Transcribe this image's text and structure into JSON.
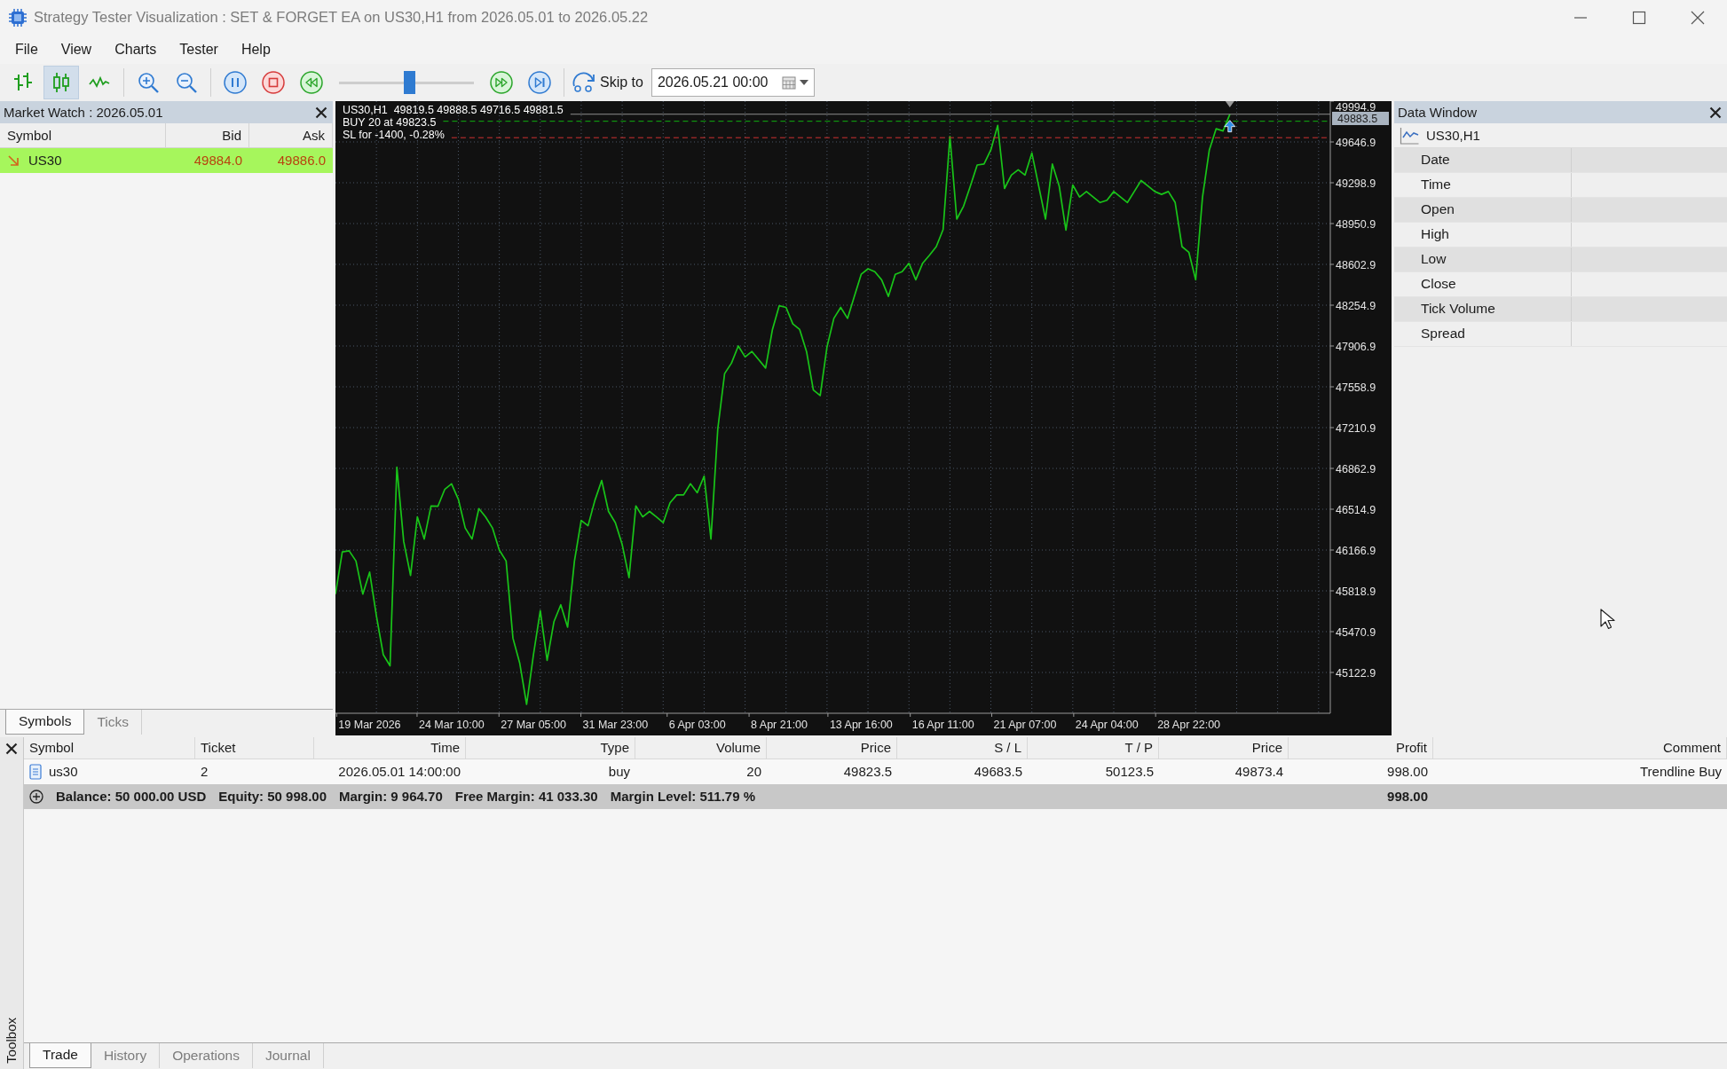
{
  "window": {
    "title": "Strategy Tester Visualization : SET & FORGET EA on US30,H1 from 2026.05.01 to 2026.05.22"
  },
  "menu": [
    "File",
    "View",
    "Charts",
    "Tester",
    "Help"
  ],
  "toolbar": {
    "chart_types": [
      {
        "kind": "bars",
        "selected": false
      },
      {
        "kind": "candles",
        "selected": true
      },
      {
        "kind": "line",
        "selected": false
      }
    ],
    "speed": {
      "level": 0.52
    },
    "skip_to": {
      "label": "Skip to",
      "value": "2026.05.21 00:00"
    }
  },
  "market_watch": {
    "title": "Market Watch : 2026.05.01",
    "columns": [
      "Symbol",
      "Bid",
      "Ask"
    ],
    "rows": [
      {
        "symbol": "US30",
        "bid": "49884.0",
        "ask": "49886.0",
        "falling": true,
        "selected": true
      }
    ],
    "tabs": [
      {
        "label": "Symbols",
        "selected": true
      },
      {
        "label": "Ticks",
        "selected": false
      }
    ]
  },
  "chart": {
    "ohlc": [
      "49819.5",
      "49888.5",
      "49716.5",
      "49881.5"
    ],
    "chart_data": {
      "type": "line",
      "grid": true,
      "categories": [
        null,
        null,
        null,
        null,
        null,
        "19 Mar 2026",
        null,
        null,
        null,
        null,
        null,
        null,
        null,
        null,
        null,
        null,
        null,
        "24 Mar 10:00",
        null,
        null,
        null,
        null,
        null,
        null,
        null,
        null,
        null,
        null,
        null,
        "27 Mar 05:00",
        null,
        null,
        null,
        null,
        null,
        null,
        null,
        null,
        null,
        null,
        null,
        "31 Mar 23:00",
        null,
        null,
        null,
        null,
        null,
        null,
        null,
        null,
        null,
        null,
        null,
        "6 Apr 03:00",
        null,
        null,
        null,
        null,
        null,
        null,
        null,
        null,
        null,
        null,
        null,
        "8 Apr 21:00",
        null,
        null,
        null,
        null,
        null,
        null,
        null,
        null,
        null,
        null,
        null,
        "13 Apr 16:00",
        null,
        null,
        null,
        null,
        null,
        null,
        null,
        null,
        null,
        null,
        null,
        "16 Apr 11:00",
        null,
        null,
        null,
        null,
        null,
        null,
        null,
        null,
        null,
        null,
        null,
        "21 Apr 07:00",
        null,
        null,
        null,
        null,
        null,
        null,
        null,
        null,
        null,
        null,
        null,
        "24 Apr 04:00",
        null,
        null,
        null,
        null,
        null,
        null,
        null,
        null,
        null,
        null,
        null,
        "28 Apr 22:00",
        null,
        null,
        null,
        null,
        null,
        null
      ],
      "series": [
        {
          "name": "US30,H1",
          "color": "#19c419",
          "values": [
            45791,
            46150,
            46160,
            46073,
            45791,
            45979,
            45603,
            45274,
            45180,
            46873,
            46240,
            45950,
            46449,
            46261,
            46543,
            46540,
            46684,
            46732,
            46600,
            46355,
            46261,
            46520,
            46449,
            46355,
            46167,
            46073,
            45415,
            45200,
            44851,
            45274,
            45650,
            45227,
            45556,
            45700,
            45509,
            46073,
            46420,
            46374,
            46590,
            46760,
            46496,
            46400,
            46214,
            45932,
            46543,
            46450,
            46496,
            46449,
            46400,
            46570,
            46637,
            46637,
            46732,
            46656,
            46797,
            46261,
            47200,
            47672,
            47760,
            47907,
            47813,
            47860,
            47790,
            47719,
            48048,
            48250,
            48236,
            48095,
            48048,
            47860,
            47531,
            47484,
            47900,
            48142,
            48236,
            48142,
            48330,
            48518,
            48565,
            48540,
            48471,
            48330,
            48518,
            48540,
            48612,
            48471,
            48612,
            48680,
            48754,
            48900,
            49694,
            48989,
            49100,
            49271,
            49450,
            49459,
            49580,
            49788,
            49250,
            49365,
            49410,
            49365,
            49553,
            49271,
            48989,
            49459,
            49271,
            48895,
            49280,
            49177,
            49224,
            49177,
            49130,
            49150,
            49224,
            49177,
            49130,
            49224,
            49318,
            49271,
            49224,
            49200,
            49224,
            49130,
            48754,
            48707,
            48471,
            49177,
            49580,
            49760,
            49741,
            49882
          ]
        }
      ],
      "ylim": [
        44775,
        49995
      ],
      "yticks": [
        49994.9,
        49646.9,
        49298.9,
        48950.9,
        48602.9,
        48254.9,
        47906.9,
        47558.9,
        47210.9,
        46862.9,
        46514.9,
        46166.9,
        45818.9,
        45470.9,
        45122.9
      ],
      "ref_lines": [
        {
          "axis": "y",
          "value": 49883.5,
          "label": "49883.5",
          "color": "#8c8c8c"
        },
        {
          "axis": "y",
          "value": 49823.5,
          "label": "BUY 20 at 49823.5",
          "color": "#10b010"
        },
        {
          "axis": "y",
          "value": 49683.5,
          "label": "SL for -1400, -0.28%",
          "color": "#d03232"
        }
      ]
    }
  },
  "data_window": {
    "title": "Data Window",
    "symbol": "US30,H1",
    "fields": [
      "Date",
      "Time",
      "Open",
      "High",
      "Low",
      "Close",
      "Tick Volume",
      "Spread"
    ]
  },
  "toolbox": {
    "title": "Toolbox",
    "columns": [
      "Symbol",
      "Ticket",
      "Time",
      "Type",
      "Volume",
      "Price",
      "S / L",
      "T / P",
      "Price",
      "Profit",
      "Comment"
    ],
    "rows": [
      {
        "cells": [
          "us30",
          "2",
          "2026.05.01 14:00:00",
          "buy",
          "20",
          "49823.5",
          "49683.5",
          "50123.5",
          "49873.4",
          "998.00",
          "Trendline Buy"
        ]
      }
    ],
    "summary": {
      "parts": [
        "Balance: 50 000.00 USD",
        "Equity: 50 998.00",
        "Margin: 9 964.70",
        "Free Margin: 41 033.30",
        "Margin Level: 511.79 %"
      ],
      "profit": "998.00"
    },
    "tabs": [
      {
        "label": "Trade",
        "selected": true
      },
      {
        "label": "History",
        "selected": false
      },
      {
        "label": "Operations",
        "selected": false
      },
      {
        "label": "Journal",
        "selected": false
      }
    ]
  }
}
